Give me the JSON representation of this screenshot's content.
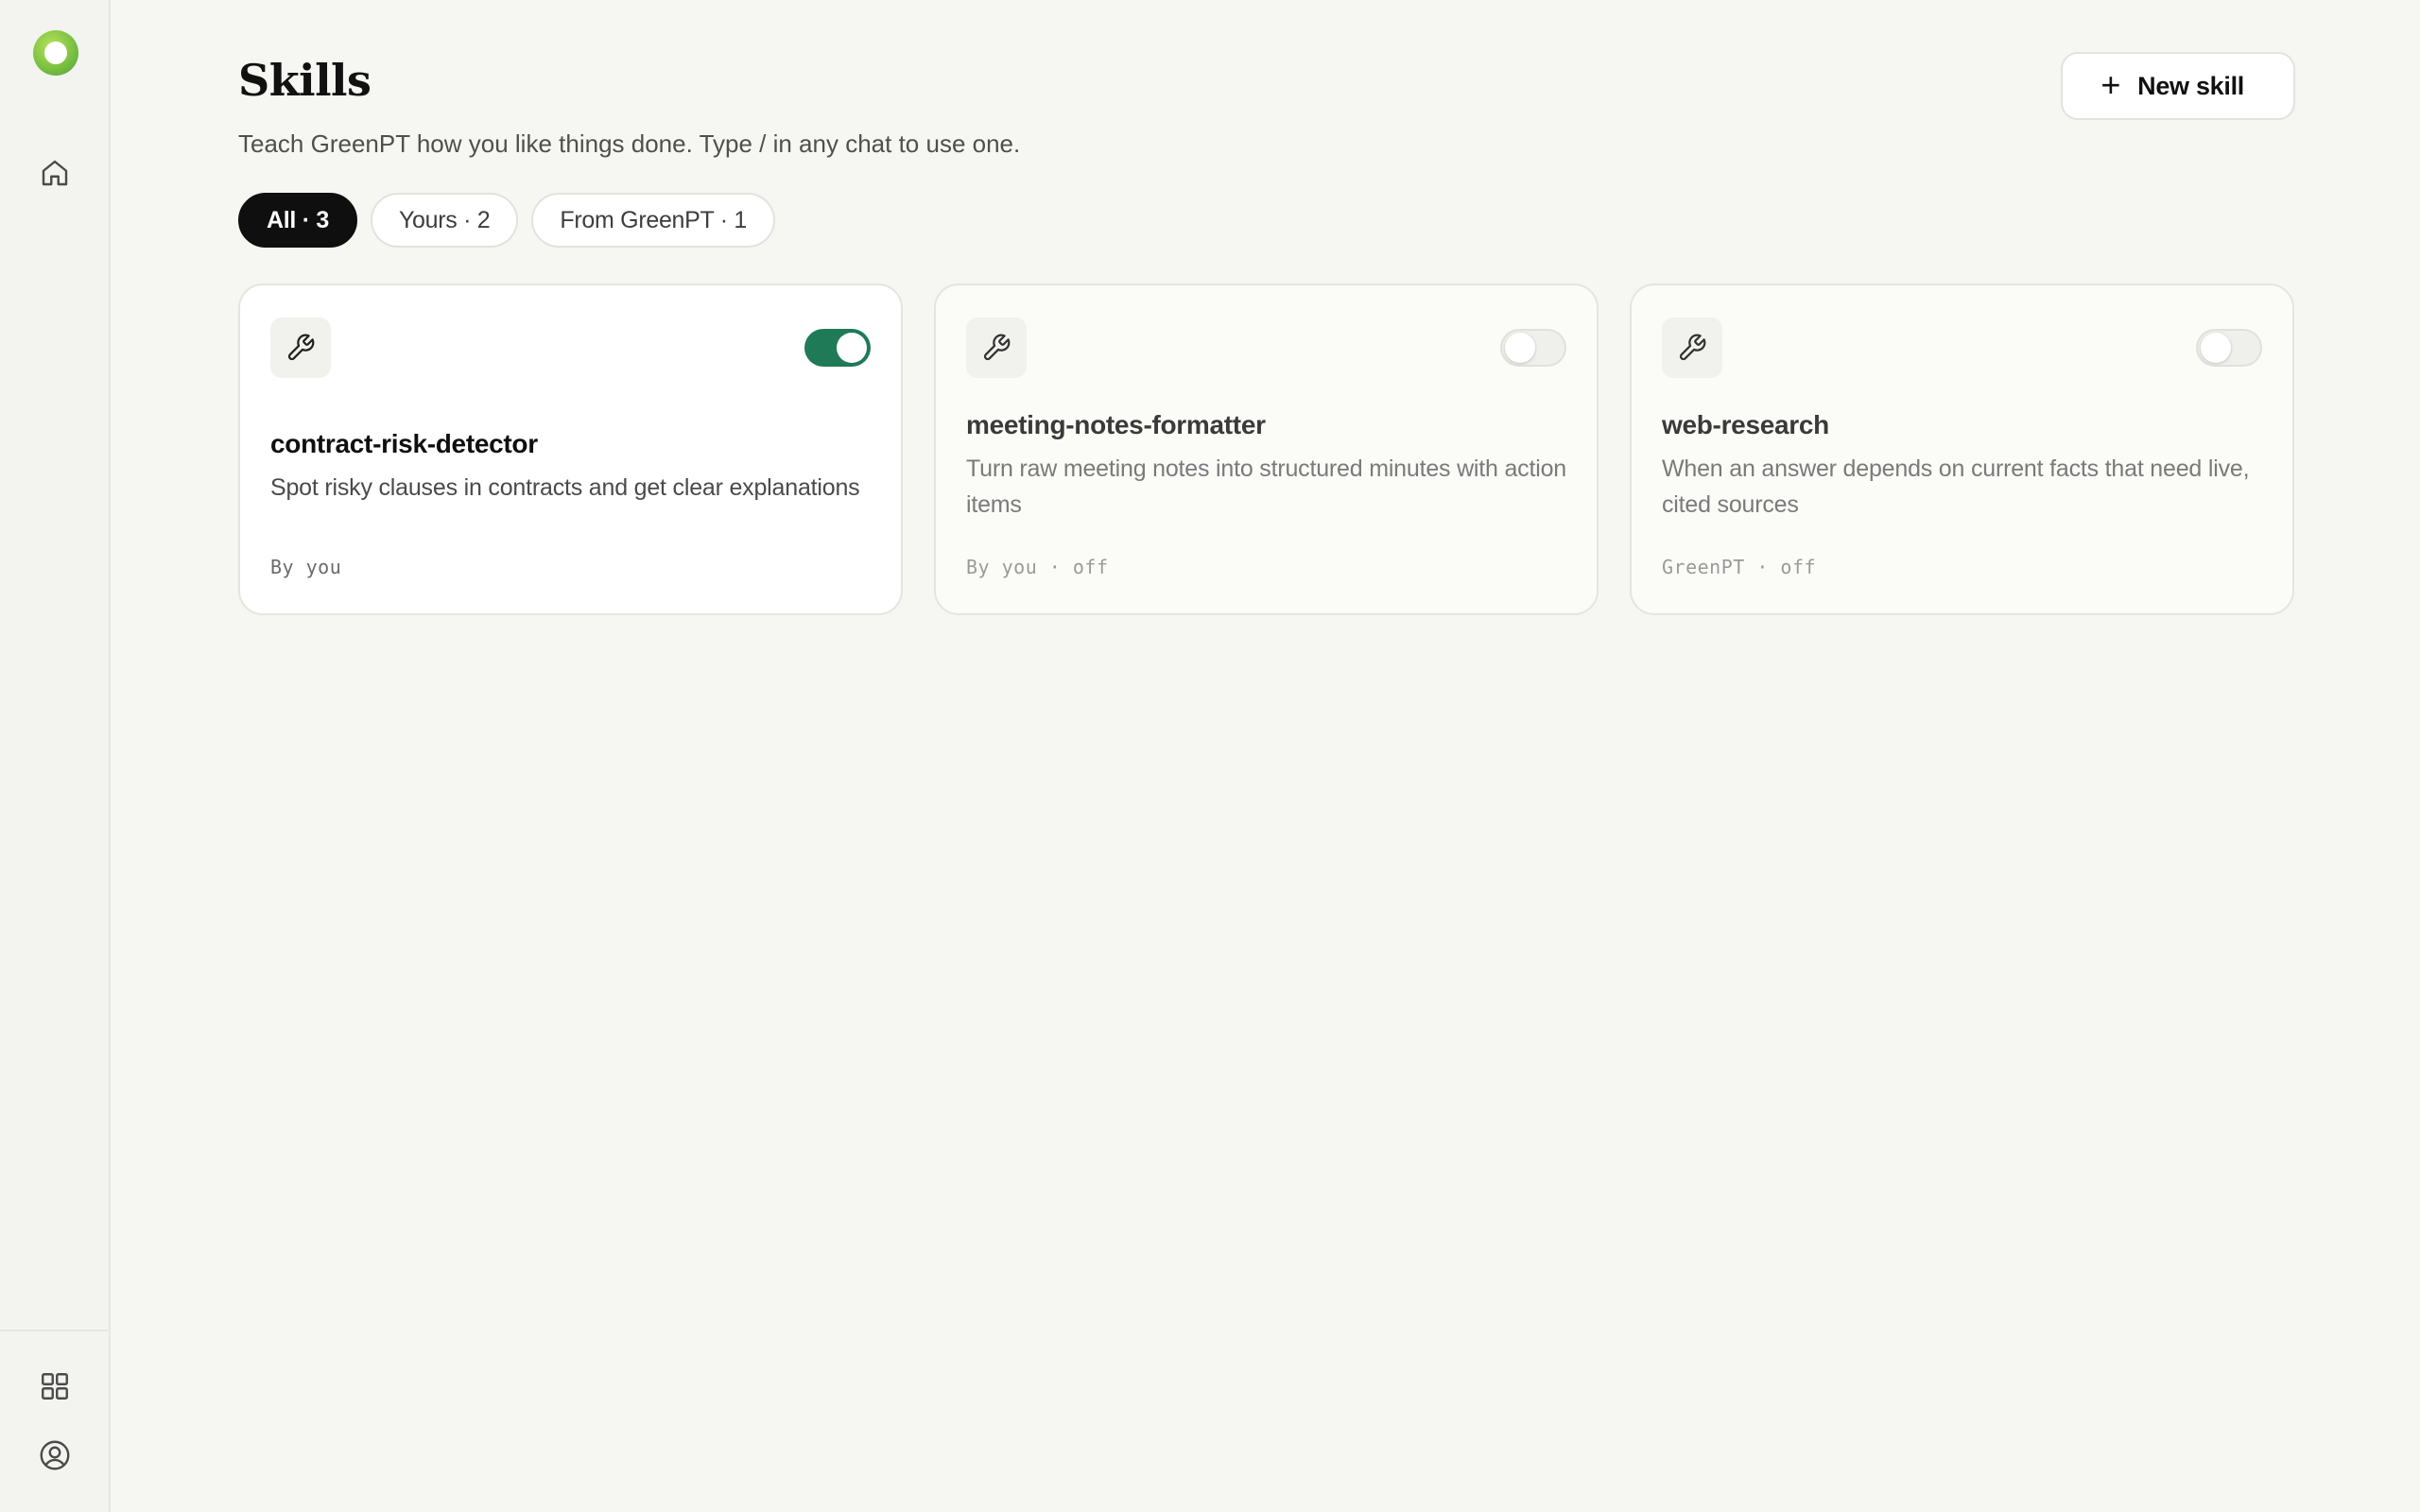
{
  "page": {
    "title": "Skills",
    "subtitle": "Teach GreenPT how you like things done. Type / in any chat to use one.",
    "new_skill_label": "New skill"
  },
  "sidebar": {
    "top_items": [
      {
        "icon": "home-icon"
      }
    ],
    "bottom_items": [
      {
        "icon": "grid-icon"
      },
      {
        "icon": "user-circle-icon"
      }
    ]
  },
  "filters": [
    {
      "label": "All · 3",
      "active": true
    },
    {
      "label": "Yours · 2",
      "active": false
    },
    {
      "label": "From GreenPT · 1",
      "active": false
    }
  ],
  "skills": [
    {
      "name": "contract-risk-detector",
      "description": "Spot risky clauses in contracts and get clear explanations",
      "meta": "By you",
      "enabled": true,
      "icon": "wrench-icon"
    },
    {
      "name": "meeting-notes-formatter",
      "description": "Turn raw meeting notes into structured minutes with action items",
      "meta": "By you · off",
      "enabled": false,
      "icon": "wrench-icon"
    },
    {
      "name": "web-research",
      "description": "When an answer depends on current facts that need live, cited sources",
      "meta": "GreenPT · off",
      "enabled": false,
      "icon": "wrench-icon"
    }
  ],
  "colors": {
    "accent": "#1f7a57",
    "background": "#f6f6f2",
    "active_pill": "#0f0f0f"
  }
}
